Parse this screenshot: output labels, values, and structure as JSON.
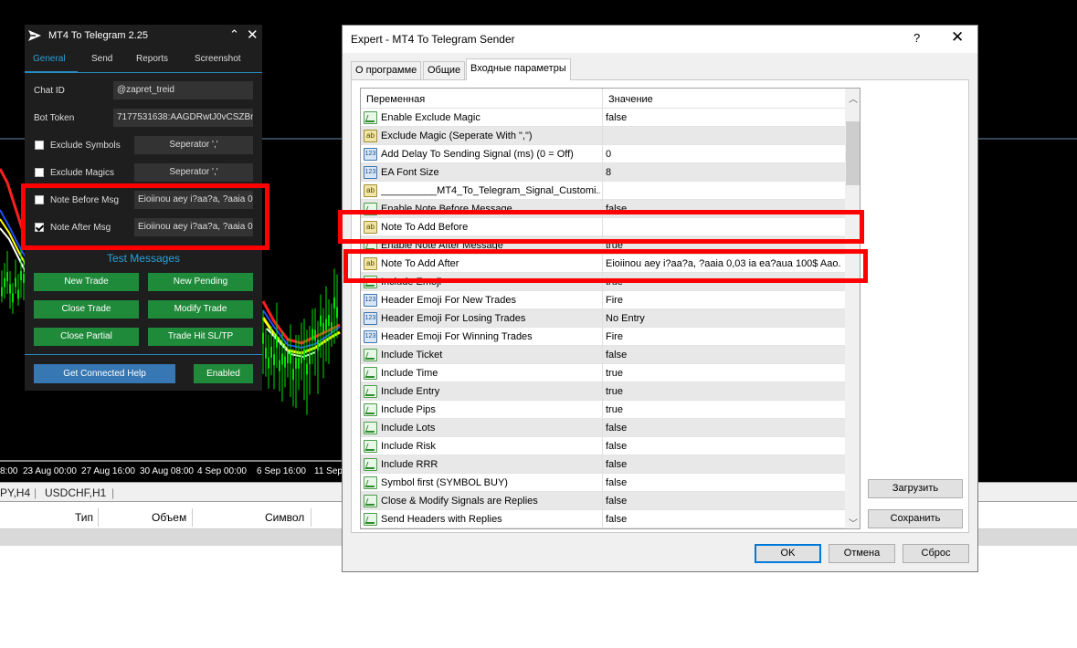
{
  "chart": {
    "x_labels": [
      "8:00",
      "23 Aug 00:00",
      "27 Aug 16:00",
      "30 Aug 08:00",
      "4 Sep 00:00",
      "6 Sep 16:00",
      "11 Sep"
    ],
    "symbol_tabs": [
      "PY,H4",
      "USDCHF,H1"
    ],
    "trade_columns": [
      "Тип",
      "Объем",
      "Символ"
    ]
  },
  "panel": {
    "title": "MT4 To Telegram 2.25",
    "tabs": [
      "General",
      "Send",
      "Reports",
      "Screenshot"
    ],
    "chat_id_label": "Chat ID",
    "chat_id_value": "@zapret_treid",
    "bot_token_label": "Bot Token",
    "bot_token_value": "7177531638:AAGDRwtJ0vCSZBr",
    "exclude_symbols_label": "Exclude Symbols",
    "exclude_magics_label": "Exclude Magics",
    "separator_label": "Seperator ','",
    "note_before_label": "Note Before Msg",
    "note_before_value": "Eioiinou aey i?aa?a, ?aaia 0",
    "note_after_label": "Note After Msg",
    "note_after_value": "Eioiinou aey i?aa?a, ?aaia 0",
    "test_messages": "Test Messages",
    "buttons": [
      "New Trade",
      "New Pending",
      "Close Trade",
      "Modify Trade",
      "Close Partial",
      "Trade Hit SL/TP"
    ],
    "help_button": "Get Connected Help",
    "enabled_button": "Enabled",
    "checks": {
      "exclude_symbols": false,
      "exclude_magics": false,
      "note_before": false,
      "note_after": true
    }
  },
  "dialog": {
    "title": "Expert - MT4 To Telegram Sender",
    "help": "?",
    "close": "✕",
    "tabs": [
      "О программе",
      "Общие",
      "Входные параметры"
    ],
    "col_variable": "Переменная",
    "col_value": "Значение",
    "rows": [
      {
        "type": "bool",
        "name": "Enable Exclude Magic",
        "value": "false"
      },
      {
        "type": "str",
        "name": "Exclude Magic (Seperate With \",\")",
        "value": ""
      },
      {
        "type": "int",
        "name": "Add Delay To Sending Signal (ms) (0 = Off)",
        "value": "0"
      },
      {
        "type": "int",
        "name": "EA Font Size",
        "value": "8"
      },
      {
        "type": "str",
        "name": "__________MT4_To_Telegram_Signal_Customi...",
        "value": ""
      },
      {
        "type": "bool",
        "name": "Enable Note Before Message",
        "value": "false"
      },
      {
        "type": "str",
        "name": "Note To Add Before",
        "value": ""
      },
      {
        "type": "bool",
        "name": "Enable Note After Message",
        "value": "true"
      },
      {
        "type": "str",
        "name": "Note To Add After",
        "value": "Eioiinou aey i?aa?a, ?aaia 0,03 ia ea?aua 100$ Aao..."
      },
      {
        "type": "bool",
        "name": "Include Emoji",
        "value": "true"
      },
      {
        "type": "int",
        "name": "Header Emoji For New Trades",
        "value": "Fire"
      },
      {
        "type": "int",
        "name": "Header Emoji For Losing Trades",
        "value": "No Entry"
      },
      {
        "type": "int",
        "name": "Header Emoji For Winning Trades",
        "value": "Fire"
      },
      {
        "type": "bool",
        "name": "Include Ticket",
        "value": "false"
      },
      {
        "type": "bool",
        "name": "Include Time",
        "value": "true"
      },
      {
        "type": "bool",
        "name": "Include Entry",
        "value": "true"
      },
      {
        "type": "bool",
        "name": "Include Pips",
        "value": "true"
      },
      {
        "type": "bool",
        "name": "Include Lots",
        "value": "false"
      },
      {
        "type": "bool",
        "name": "Include Risk",
        "value": "false"
      },
      {
        "type": "bool",
        "name": "Include RRR",
        "value": "false"
      },
      {
        "type": "bool",
        "name": "Symbol first (SYMBOL BUY)",
        "value": "false"
      },
      {
        "type": "bool",
        "name": "Close & Modify Signals are Replies",
        "value": "false"
      },
      {
        "type": "bool",
        "name": "Send Headers with Replies",
        "value": "false"
      }
    ],
    "load_button": "Загрузить",
    "save_button": "Сохранить",
    "ok_button": "OK",
    "cancel_button": "Отмена",
    "reset_button": "Сброс"
  },
  "icon_text": {
    "str": "ab",
    "int": "123"
  },
  "colors": {
    "accent": "#2a8bc0",
    "green_button": "#1f8a3a",
    "help_button": "#3778b4",
    "highlight": "#ff0000"
  }
}
